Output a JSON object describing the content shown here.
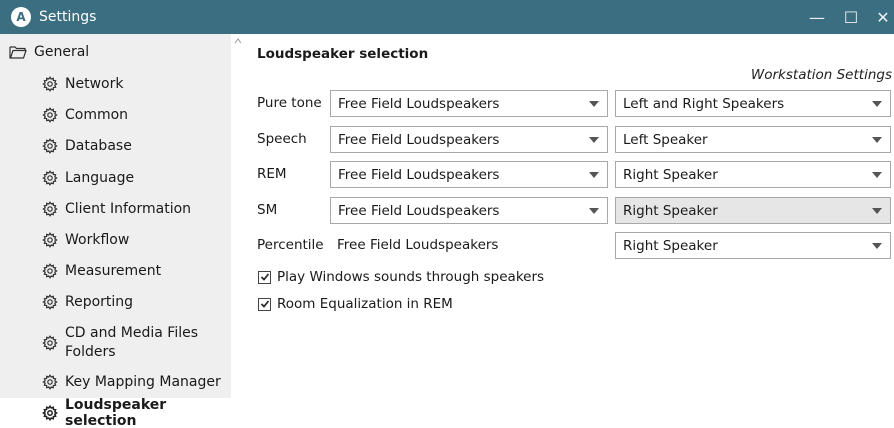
{
  "window": {
    "app_icon_letter": "A",
    "title": "Settings",
    "controls": {
      "minimize": "—",
      "maximize": "☐",
      "close": "✕"
    }
  },
  "sidebar": {
    "root": {
      "label": "General"
    },
    "items": [
      {
        "label": "Network"
      },
      {
        "label": "Common"
      },
      {
        "label": "Database"
      },
      {
        "label": "Language"
      },
      {
        "label": "Client Information"
      },
      {
        "label": "Workflow"
      },
      {
        "label": "Measurement"
      },
      {
        "label": "Reporting"
      },
      {
        "label": "CD and Media Files Folders"
      },
      {
        "label": "Key Mapping Manager"
      },
      {
        "label": "Loudspeaker selection",
        "selected": true
      }
    ]
  },
  "content": {
    "heading": "Loudspeaker selection",
    "workstation_label": "Workstation Settings",
    "rows": [
      {
        "label": "Pure tone",
        "source": "Free Field Loudspeakers",
        "speaker": "Left and Right Speakers"
      },
      {
        "label": "Speech",
        "source": "Free Field Loudspeakers",
        "speaker": "Left Speaker"
      },
      {
        "label": "REM",
        "source": "Free Field Loudspeakers",
        "speaker": "Right Speaker"
      },
      {
        "label": "SM",
        "source": "Free Field Loudspeakers",
        "speaker": "Right Speaker"
      },
      {
        "label": "Percentile",
        "source": "Free Field Loudspeakers",
        "speaker": "Right Speaker"
      }
    ],
    "checkboxes": [
      {
        "label": "Play Windows sounds through speakers",
        "checked": true
      },
      {
        "label": "Room Equalization in REM",
        "checked": true
      }
    ]
  },
  "colors": {
    "titlebar": "#3b6e80",
    "sidebar_bg": "#efefef",
    "selected_bg": "#ffffff"
  }
}
